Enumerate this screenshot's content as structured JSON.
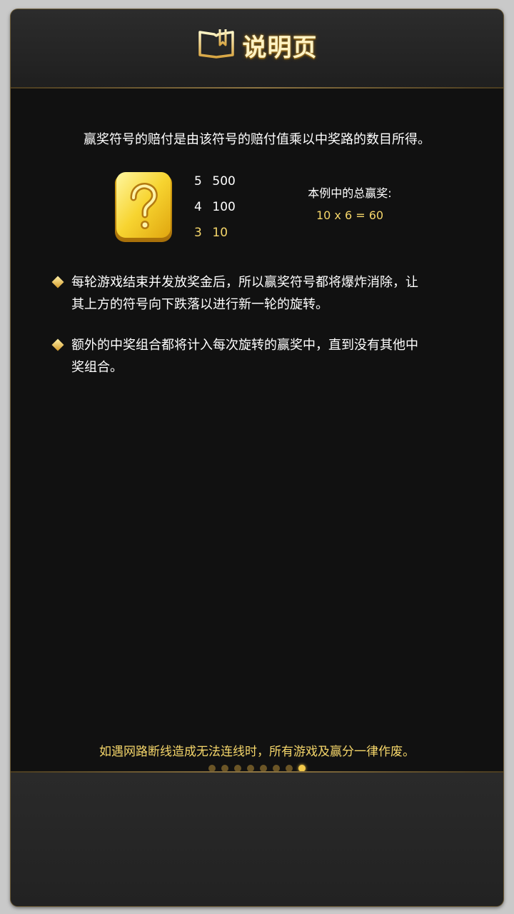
{
  "header": {
    "title": "说明页",
    "icon": "book-icon",
    "accent": "#fff3c4"
  },
  "intro": "赢奖符号的赔付是由该符号的赔付值乘以中奖路的数目所得。",
  "symbol": {
    "icon": "question-mark-icon",
    "color": "#f6d23a"
  },
  "paytable": [
    {
      "count": "5",
      "payout": "500"
    },
    {
      "count": "4",
      "payout": "100"
    },
    {
      "count": "3",
      "payout": "10"
    }
  ],
  "example": {
    "label": "本例中的总赢奖:",
    "value": "10 x 6 = 60"
  },
  "bullets": [
    {
      "line1": "每轮游戏结束并发放奖金后，所以赢奖符号都将爆炸消除，让",
      "line2": "其上方的符号向下跌落以进行新一轮的旋转。"
    },
    {
      "line1": "额外的中奖组合都将计入每次旋转的赢奖中，直到没有其他中",
      "line2": "奖组合。"
    }
  ],
  "notice": "如遇网路断线造成无法连线时，所有游戏及赢分一律作废。",
  "pagination": {
    "total": 8,
    "current": 8
  },
  "colors": {
    "gold": "#f5d66a",
    "background": "#111111",
    "frame": "#262626"
  }
}
